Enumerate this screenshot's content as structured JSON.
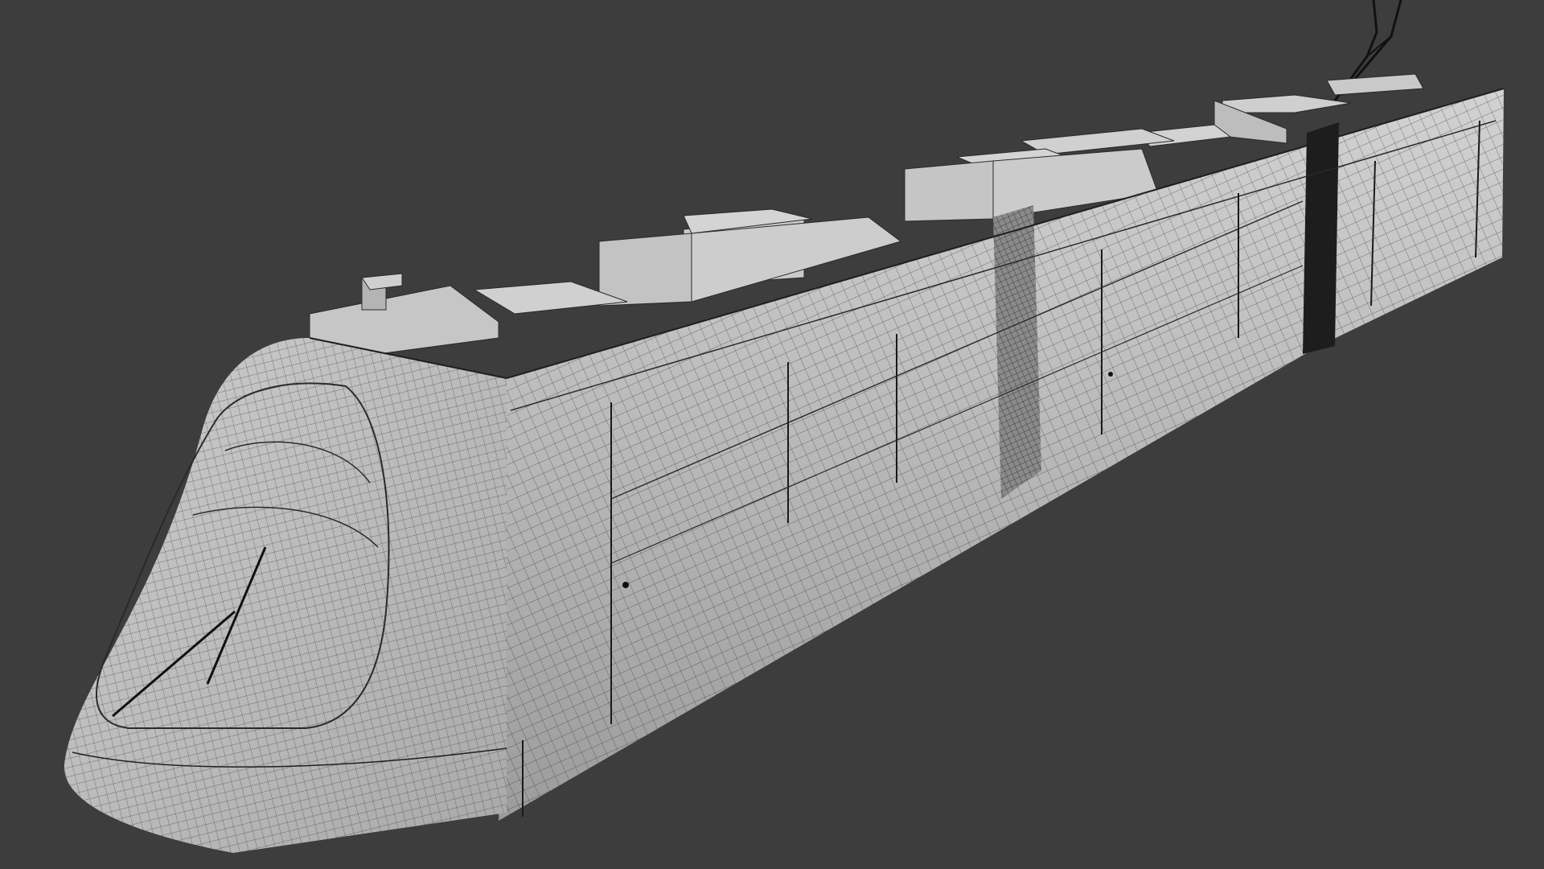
{
  "viewport": {
    "background_color": "#3d3d3d",
    "render_mode": "wireframe-on-shaded",
    "subject": "tram",
    "shading_color": "#b9b9b9",
    "wire_color": "#2a2a2a"
  }
}
